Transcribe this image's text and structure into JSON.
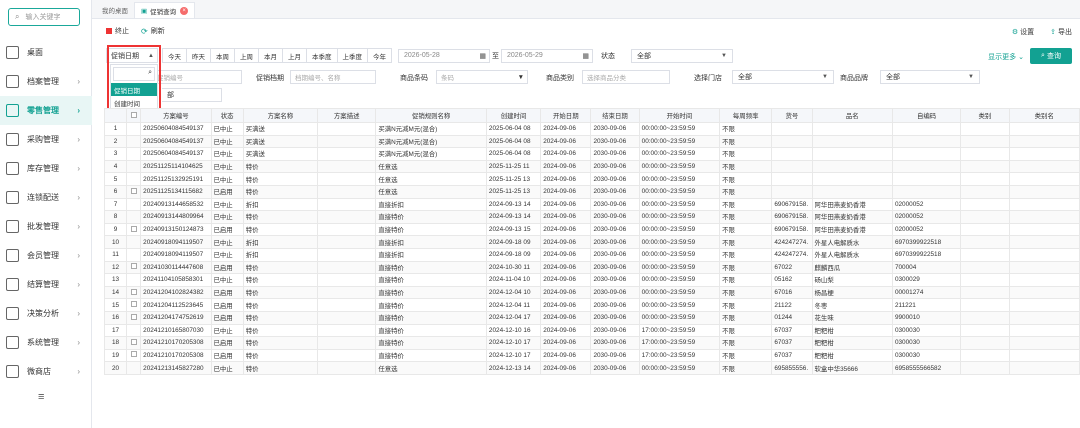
{
  "sidebar": {
    "search_placeholder": "输入关键字",
    "items": [
      {
        "label": "桌面",
        "icon": "desktop-icon",
        "active": false,
        "arrow": ""
      },
      {
        "label": "档案管理",
        "icon": "archive-icon",
        "active": false,
        "arrow": "›"
      },
      {
        "label": "零售管理",
        "icon": "retail-icon",
        "active": true,
        "arrow": "›"
      },
      {
        "label": "采购管理",
        "icon": "purchase-icon",
        "active": false,
        "arrow": "›"
      },
      {
        "label": "库存管理",
        "icon": "inventory-icon",
        "active": false,
        "arrow": "›"
      },
      {
        "label": "连锁配送",
        "icon": "delivery-icon",
        "active": false,
        "arrow": "›"
      },
      {
        "label": "批发管理",
        "icon": "wholesale-icon",
        "active": false,
        "arrow": "›"
      },
      {
        "label": "会员管理",
        "icon": "member-icon",
        "active": false,
        "arrow": "›"
      },
      {
        "label": "结算管理",
        "icon": "settlement-icon",
        "active": false,
        "arrow": "›"
      },
      {
        "label": "决策分析",
        "icon": "analysis-icon",
        "active": false,
        "arrow": "›"
      },
      {
        "label": "系统管理",
        "icon": "system-icon",
        "active": false,
        "arrow": "›"
      },
      {
        "label": "微商店",
        "icon": "shop-icon",
        "active": false,
        "arrow": "›"
      }
    ],
    "collapse_icon": "≡"
  },
  "tabs": [
    {
      "label": "我的桌面"
    },
    {
      "label": "促销查询",
      "close": "×"
    }
  ],
  "toolbar": {
    "stop": "终止",
    "refresh": "刷新",
    "settings": "设置",
    "export": "导出"
  },
  "filters": {
    "date_type": "促销日期",
    "quick_dates": [
      "今天",
      "昨天",
      "本周",
      "上周",
      "本月",
      "上月",
      "本季度",
      "上季度",
      "今年"
    ],
    "date_from": "2026-05-28",
    "date_sep": "至",
    "date_to": "2026-05-29",
    "status_label": "状态",
    "status_value": "全部",
    "show_more": "显示更多",
    "query": "查询",
    "code_placeholder": "促销编号",
    "range_label": "促销档期",
    "range_placeholder": "档期编号、名称",
    "barcode_label": "商品条码",
    "barcode_placeholder": "条码",
    "category_label": "商品类别",
    "category_placeholder": "选择商品分类",
    "store_label": "选择门店",
    "store_value": "全部",
    "brand_label": "商品品牌",
    "brand_value": "全部",
    "row3_value": "部"
  },
  "dropdown": {
    "options": [
      "促销日期",
      "创建时间"
    ]
  },
  "table": {
    "headers": [
      "",
      "",
      "方案编号",
      "状态",
      "方案名称",
      "方案描述",
      "促销规则名称",
      "创建时间",
      "开始日期",
      "结束日期",
      "开始时间",
      "每周频率",
      "货号",
      "品名",
      "自编码",
      "类别",
      "类别名"
    ],
    "rows": [
      [
        "1",
        "",
        "20250604084549137",
        "已中止",
        "买满送",
        "",
        "买满N元减M元(混合)",
        "2025-06-04 08",
        "2024-09-06",
        "2030-09-06",
        "00:00:00~23:59:59",
        "不限",
        "",
        "",
        "",
        "",
        ""
      ],
      [
        "2",
        "",
        "20250604084549137",
        "已中止",
        "买满送",
        "",
        "买满N元减M元(混合)",
        "2025-06-04 08",
        "2024-09-06",
        "2030-09-06",
        "00:00:00~23:59:59",
        "不限",
        "",
        "",
        "",
        "",
        ""
      ],
      [
        "3",
        "",
        "20250604084549137",
        "已中止",
        "买满送",
        "",
        "买满N元减M元(混合)",
        "2025-06-04 08",
        "2024-09-06",
        "2030-09-06",
        "00:00:00~23:59:59",
        "不限",
        "",
        "",
        "",
        "",
        ""
      ],
      [
        "4",
        "",
        "20251125114104625",
        "已中止",
        "特价",
        "",
        "任意选",
        "2025-11-25 11",
        "2024-09-06",
        "2030-09-06",
        "00:00:00~23:59:59",
        "不限",
        "",
        "",
        "",
        "",
        ""
      ],
      [
        "5",
        "",
        "20251125132925191",
        "已中止",
        "特价",
        "",
        "任意选",
        "2025-11-25 13",
        "2024-09-06",
        "2030-09-06",
        "00:00:00~23:59:59",
        "不限",
        "",
        "",
        "",
        "",
        ""
      ],
      [
        "6",
        "☐",
        "20251125134115682",
        "已启用",
        "特价",
        "",
        "任意选",
        "2025-11-25 13",
        "2024-09-06",
        "2030-09-06",
        "00:00:00~23:59:59",
        "不限",
        "",
        "",
        "",
        "",
        ""
      ],
      [
        "7",
        "",
        "20240913144658532",
        "已中止",
        "折扣",
        "",
        "直接折扣",
        "2024-09-13 14",
        "2024-09-06",
        "2030-09-06",
        "00:00:00~23:59:59",
        "不限",
        "690679158.",
        "阿华田燕麦奶香港",
        "02000052",
        "",
        ""
      ],
      [
        "8",
        "",
        "20240913144809964",
        "已中止",
        "特价",
        "",
        "直接特价",
        "2024-09-13 14",
        "2024-09-06",
        "2030-09-06",
        "00:00:00~23:59:59",
        "不限",
        "690679158.",
        "阿华田燕麦奶香港",
        "02000052",
        "",
        ""
      ],
      [
        "9",
        "☐",
        "20240913150124873",
        "已启用",
        "特价",
        "",
        "直接特价",
        "2024-09-13 15",
        "2024-09-06",
        "2030-09-06",
        "00:00:00~23:59:59",
        "不限",
        "690679158.",
        "阿华田燕麦奶香港",
        "02000052",
        "",
        ""
      ],
      [
        "10",
        "",
        "20240918094119507",
        "已中止",
        "折扣",
        "",
        "直接折扣",
        "2024-09-18 09",
        "2024-09-06",
        "2030-09-06",
        "00:00:00~23:59:59",
        "不限",
        "424247274.",
        "外星人电解质水",
        "6970399922518",
        "",
        ""
      ],
      [
        "11",
        "",
        "20240918094119507",
        "已中止",
        "折扣",
        "",
        "直接折扣",
        "2024-09-18 09",
        "2024-09-06",
        "2030-09-06",
        "00:00:00~23:59:59",
        "不限",
        "424247274.",
        "外星人电解质水",
        "6970399922518",
        "",
        ""
      ],
      [
        "12",
        "☐",
        "20241030114447608",
        "已启用",
        "特价",
        "",
        "直接特价",
        "2024-10-30 11",
        "2024-09-06",
        "2030-09-06",
        "00:00:00~23:59:59",
        "不限",
        "67022",
        "麒麟西瓜",
        "700004",
        "",
        ""
      ],
      [
        "13",
        "",
        "20241104105858301",
        "已中止",
        "特价",
        "",
        "直接特价",
        "2024-11-04 10",
        "2024-09-06",
        "2030-09-06",
        "00:00:00~23:59:59",
        "不限",
        "05162",
        "砀山梨",
        "0300029",
        "",
        ""
      ],
      [
        "14",
        "☐",
        "20241204102824382",
        "已启用",
        "特价",
        "",
        "直接特价",
        "2024-12-04 10",
        "2024-09-06",
        "2030-09-06",
        "00:00:00~23:59:59",
        "不限",
        "67016",
        "杨昌梗",
        "00001274",
        "",
        ""
      ],
      [
        "15",
        "☐",
        "20241204112523645",
        "已启用",
        "特价",
        "",
        "直接特价",
        "2024-12-04 11",
        "2024-09-06",
        "2030-09-06",
        "00:00:00~23:59:59",
        "不限",
        "21122",
        "冬枣",
        "211221",
        "",
        ""
      ],
      [
        "16",
        "☐",
        "20241204174752619",
        "已启用",
        "特价",
        "",
        "直接特价",
        "2024-12-04 17",
        "2024-09-06",
        "2030-09-06",
        "00:00:00~23:59:59",
        "不限",
        "01244",
        "花生味",
        "9900010",
        "",
        ""
      ],
      [
        "17",
        "",
        "20241210165807030",
        "已中止",
        "特价",
        "",
        "直接特价",
        "2024-12-10 16",
        "2024-09-06",
        "2030-09-06",
        "17:00:00~23:59:59",
        "不限",
        "67037",
        "粑粑柑",
        "0300030",
        "",
        ""
      ],
      [
        "18",
        "☐",
        "20241210170205308",
        "已启用",
        "特价",
        "",
        "直接特价",
        "2024-12-10 17",
        "2024-09-06",
        "2030-09-06",
        "17:00:00~23:59:59",
        "不限",
        "67037",
        "粑粑柑",
        "0300030",
        "",
        ""
      ],
      [
        "19",
        "☐",
        "20241210170205308",
        "已启用",
        "特价",
        "",
        "直接特价",
        "2024-12-10 17",
        "2024-09-06",
        "2030-09-06",
        "17:00:00~23:59:59",
        "不限",
        "67037",
        "粑粑柑",
        "0300030",
        "",
        ""
      ],
      [
        "20",
        "",
        "20241213145827280",
        "已中止",
        "特价",
        "",
        "任意选",
        "2024-12-13 14",
        "2024-09-06",
        "2030-09-06",
        "00:00:00~23:59:59",
        "不限",
        "695855556.",
        "软盒中华35666",
        "6958555566582",
        "",
        ""
      ]
    ]
  },
  "colors": {
    "accent": "#12a192",
    "danger": "#e33"
  }
}
